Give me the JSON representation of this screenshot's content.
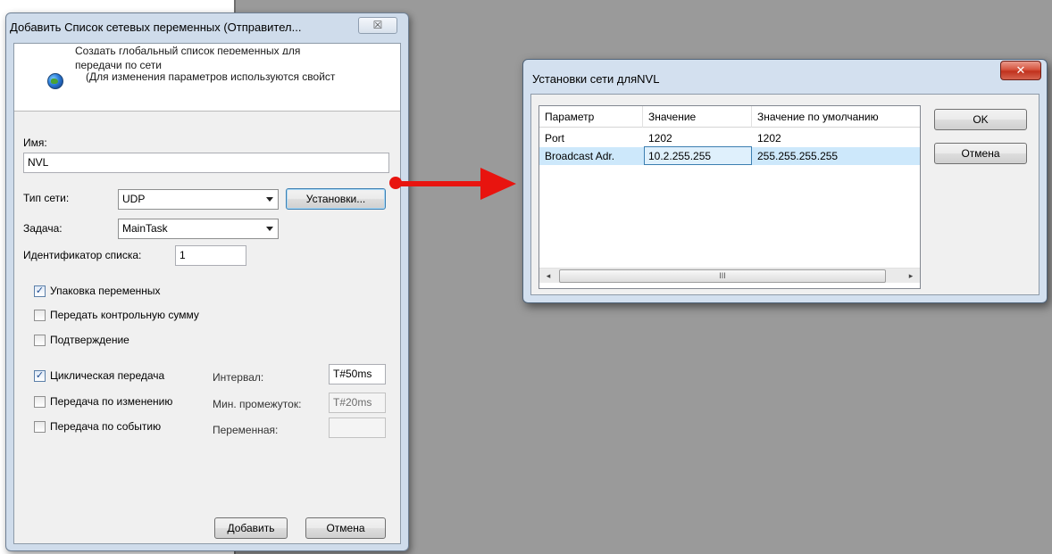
{
  "dialog_main": {
    "title": "Добавить Список сетевых переменных (Отправител...",
    "close_glyph": "☒",
    "header_lines": [
      "Создать глобальный список переменных для",
      "передачи по сети",
      "(Для изменения параметров используются свойст"
    ],
    "name_label": "Имя:",
    "name_value": "NVL",
    "network_type_label": "Тип сети:",
    "network_type_value": "UDP",
    "settings_button": "Установки...",
    "task_label": "Задача:",
    "task_value": "MainTask",
    "list_id_label": "Идентификатор списка:",
    "list_id_value": "1",
    "checkboxes": [
      {
        "label": "Упаковка переменных",
        "checked": true
      },
      {
        "label": "Передать контрольную сумму",
        "checked": false
      },
      {
        "label": "Подтверждение",
        "checked": false
      },
      {
        "label": "Циклическая передача",
        "checked": true
      },
      {
        "label": "Передача по изменению",
        "checked": false
      },
      {
        "label": "Передача по событию",
        "checked": false
      }
    ],
    "interval_label": "Интервал:",
    "interval_value": "T#50ms",
    "min_gap_label": "Мин. промежуток:",
    "min_gap_value": "T#20ms",
    "variable_label": "Переменная:",
    "variable_value": "",
    "add_button": "Добавить",
    "cancel_button": "Отмена"
  },
  "dialog_settings": {
    "title": "Установки сети дляNVL",
    "close_glyph": "✕",
    "columns": [
      "Параметр",
      "Значение",
      "Значение по умолчанию"
    ],
    "rows": [
      {
        "param": "Port",
        "value": "1202",
        "default": "1202"
      },
      {
        "param": "Broadcast Adr.",
        "value": "10.2.255.255",
        "default": "255.255.255.255"
      }
    ],
    "selected_row": 1,
    "scroll_left": "◂",
    "scroll_right": "▸",
    "scroll_grip": "III",
    "ok_button": "OK",
    "cancel_button": "Отмена"
  },
  "colors": {
    "arrow": "#e8140f",
    "selection": "#cde8fb",
    "desktop": "#9a9a9a"
  }
}
